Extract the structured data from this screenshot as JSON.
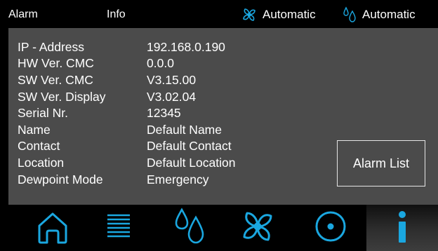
{
  "topbar": {
    "alarm_label": "Alarm",
    "info_label": "Info",
    "fan_mode": "Automatic",
    "humidity_mode": "Automatic"
  },
  "info": {
    "rows": [
      {
        "key": "IP - Address",
        "value": "192.168.0.190"
      },
      {
        "key": "HW Ver. CMC",
        "value": "0.0.0"
      },
      {
        "key": "SW Ver. CMC",
        "value": "V3.15.00"
      },
      {
        "key": "SW Ver. Display",
        "value": "V3.02.04"
      },
      {
        "key": "Serial Nr.",
        "value": "12345"
      },
      {
        "key": "Name",
        "value": "Default Name"
      },
      {
        "key": "Contact",
        "value": "Default Contact"
      },
      {
        "key": "Location",
        "value": "Default Location"
      },
      {
        "key": "Dewpoint Mode",
        "value": "Emergency"
      }
    ],
    "alarm_list_button": "Alarm List"
  },
  "navbar": {
    "items": [
      "home-icon",
      "menu-list-icon",
      "water-drops-icon",
      "fan-icon",
      "circle-dot-icon",
      "info-icon"
    ],
    "active": "info-icon"
  },
  "colors": {
    "accent": "#1aa7e0",
    "panel": "#4b4b4b",
    "background": "#000000",
    "text": "#ffffff"
  }
}
